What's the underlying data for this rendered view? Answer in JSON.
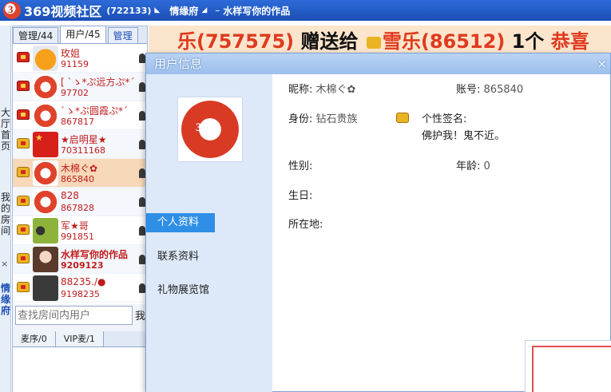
{
  "titlebar": {
    "app_title": "369视频社区",
    "room_id": "(722133)",
    "room_name": "情缘府",
    "dash": "–",
    "program": "水样写你的作品"
  },
  "left_strip": {
    "hall": "大厅首页",
    "my_room": "我的房间",
    "close": "×",
    "room": "情缘府"
  },
  "user_panel": {
    "tabs": [
      "管理/44",
      "用户/45",
      "管理"
    ],
    "users": [
      {
        "name": "玫姐",
        "id": "91159",
        "rank": "red",
        "avatar": "orange"
      },
      {
        "name": "[ `ゝ*ぷ远方ぷ*´",
        "id": "97702",
        "rank": "red",
        "avatar": "logo"
      },
      {
        "name": "`ゝ*ぷ圆霞ぷ*´",
        "id": "867817",
        "rank": "red",
        "avatar": "logo"
      },
      {
        "name": "★启明星★",
        "id": "70311168",
        "rank": "gold",
        "avatar": "flag"
      },
      {
        "name": "木棉ぐ✿",
        "id": "865840",
        "rank": "gold",
        "avatar": "logo"
      },
      {
        "name": "828",
        "id": "867828",
        "rank": "gold",
        "avatar": "logo"
      },
      {
        "name": "军★哥",
        "id": "991851",
        "rank": "gold",
        "avatar": "green"
      },
      {
        "name": "水样写你的作品",
        "id": "9209123",
        "rank": "gold",
        "avatar": "doll"
      },
      {
        "name": "88235./●",
        "id": "9198235",
        "rank": "gold",
        "avatar": "dark"
      }
    ],
    "search_placeholder": "查找房间内用户",
    "search_go": "我",
    "queue_tabs": [
      "麦序/0",
      "VIP麦/1"
    ]
  },
  "marquee": {
    "text1": "乐(757575)",
    "text2": "赠送给",
    "text3": "雪乐(86512)",
    "text4": "1个",
    "text5": "恭喜"
  },
  "dialog": {
    "title": "用户信息",
    "close": "×",
    "nav": [
      "个人资料",
      "联系资料",
      "礼物展览馆"
    ],
    "nickname_label": "昵称:",
    "nickname": "木棉ぐ✿",
    "account_label": "账号:",
    "account": "865840",
    "status_label": "身份:",
    "status": "钻石贵族",
    "signature_label": "个性签名:",
    "signature": "佛护我！鬼不近。",
    "gender_label": "性别:",
    "gender": "",
    "age_label": "年龄:",
    "age": "0",
    "birthday_label": "生日:",
    "location_label": "所在地:"
  },
  "colors": {
    "titlebar": "#1a4fb5",
    "name_red": "#c01c1c",
    "selected_row": "#f7d8b8",
    "nav_active": "#2f8fe6"
  }
}
